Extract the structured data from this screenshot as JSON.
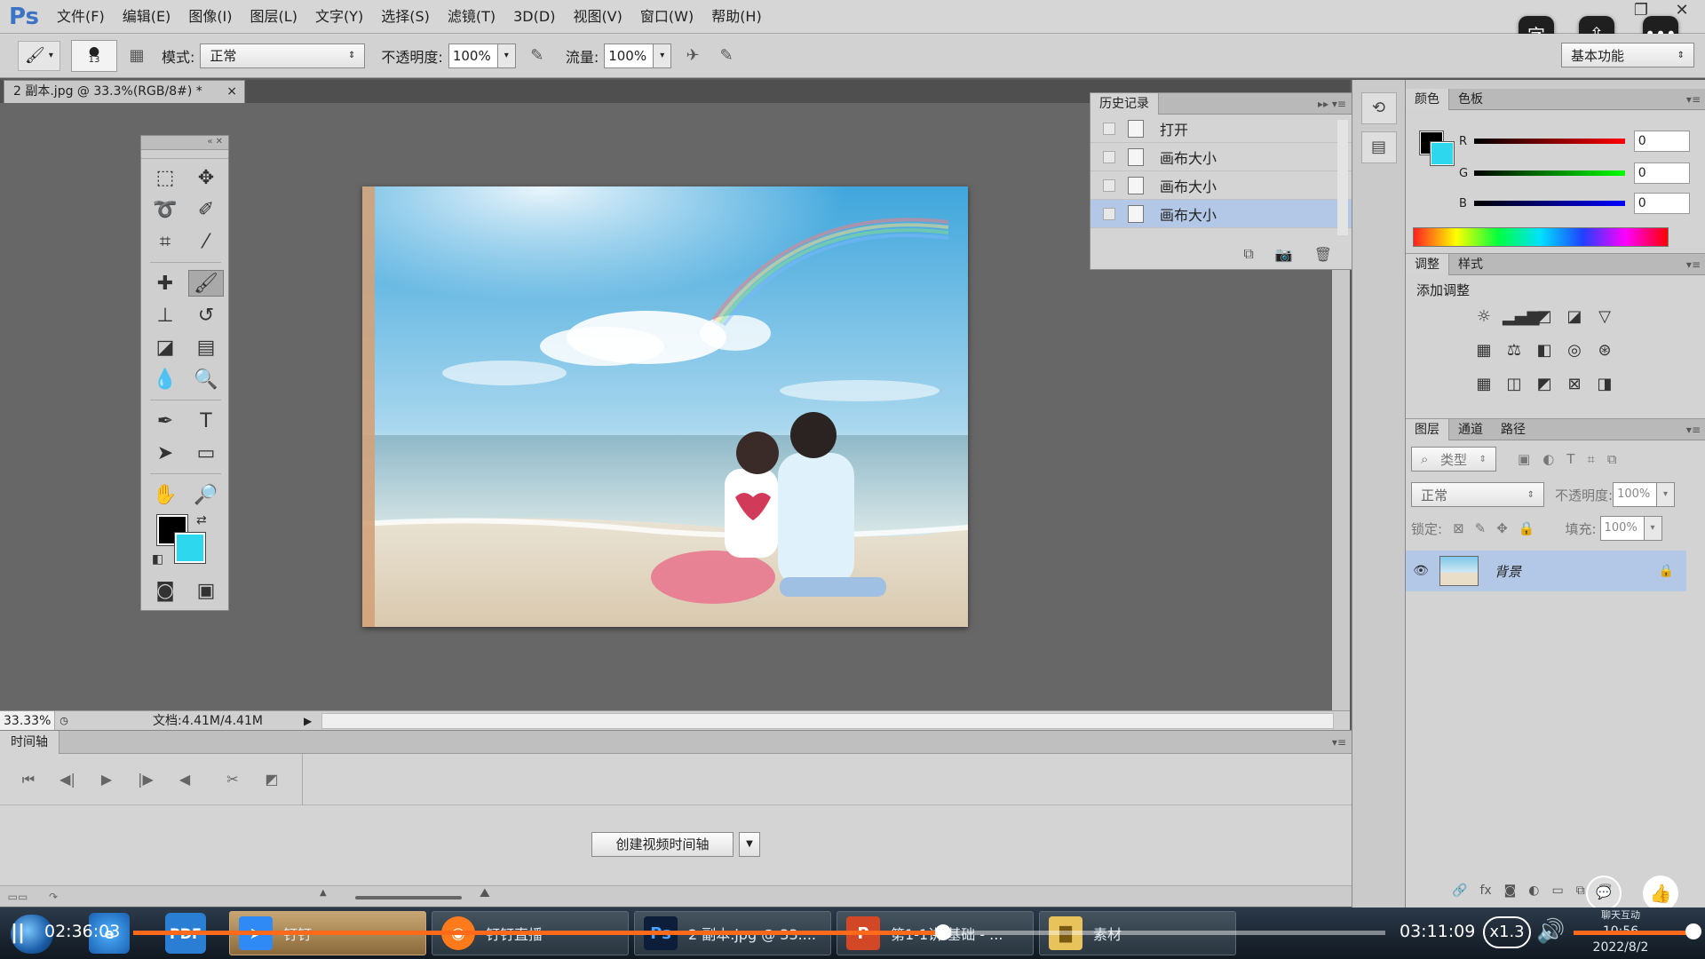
{
  "app": {
    "logo": "Ps"
  },
  "menu": [
    "文件(F)",
    "编辑(E)",
    "图像(I)",
    "图层(L)",
    "文字(Y)",
    "选择(S)",
    "滤镜(T)",
    "3D(D)",
    "视图(V)",
    "窗口(W)",
    "帮助(H)"
  ],
  "options": {
    "brush_size": "13",
    "mode_label": "模式:",
    "mode_value": "正常",
    "opacity_label": "不透明度:",
    "opacity_value": "100%",
    "flow_label": "流量:",
    "flow_value": "100%",
    "workspace": "基本功能"
  },
  "document": {
    "tab_title": "2 副本.jpg @ 33.3%(RGB/8#) *",
    "close": "×",
    "zoom": "33.33%",
    "doc_info": "文档:4.41M/4.41M"
  },
  "history": {
    "tab": "历史记录",
    "items": [
      {
        "label": "打开",
        "selected": false
      },
      {
        "label": "画布大小",
        "selected": false
      },
      {
        "label": "画布大小",
        "selected": false
      },
      {
        "label": "画布大小",
        "selected": true
      }
    ]
  },
  "color_panel": {
    "tabs": [
      "颜色",
      "色板"
    ],
    "r_label": "R",
    "g_label": "G",
    "b_label": "B",
    "r": "0",
    "g": "0",
    "b": "0",
    "foreground": "#000000",
    "background": "#2dd8ee"
  },
  "adjustments": {
    "tabs": [
      "调整",
      "样式"
    ],
    "title": "添加调整"
  },
  "layers": {
    "tabs": [
      "图层",
      "通道",
      "路径"
    ],
    "filter": "类型",
    "blend_mode": "正常",
    "opacity_label": "不透明度:",
    "opacity_value": "100%",
    "lock_label": "锁定:",
    "fill_label": "填充:",
    "fill_value": "100%",
    "items": [
      {
        "name": "背景",
        "locked": true
      }
    ]
  },
  "timeline": {
    "tab": "时间轴",
    "create_button": "创建视频时间轴"
  },
  "taskbar": {
    "items": [
      "钉钉",
      "钉钉直播",
      "2 副本.jpg @ 33....",
      "第1-1讲 基础 - ...",
      "素材"
    ]
  },
  "player": {
    "current_time": "02:36:03",
    "total_time": "03:11:09",
    "speed": "x1.3",
    "progress": 0.647,
    "chat_label": "聊天互动",
    "clock_time": "10:56",
    "clock_date": "2022/8/2"
  }
}
